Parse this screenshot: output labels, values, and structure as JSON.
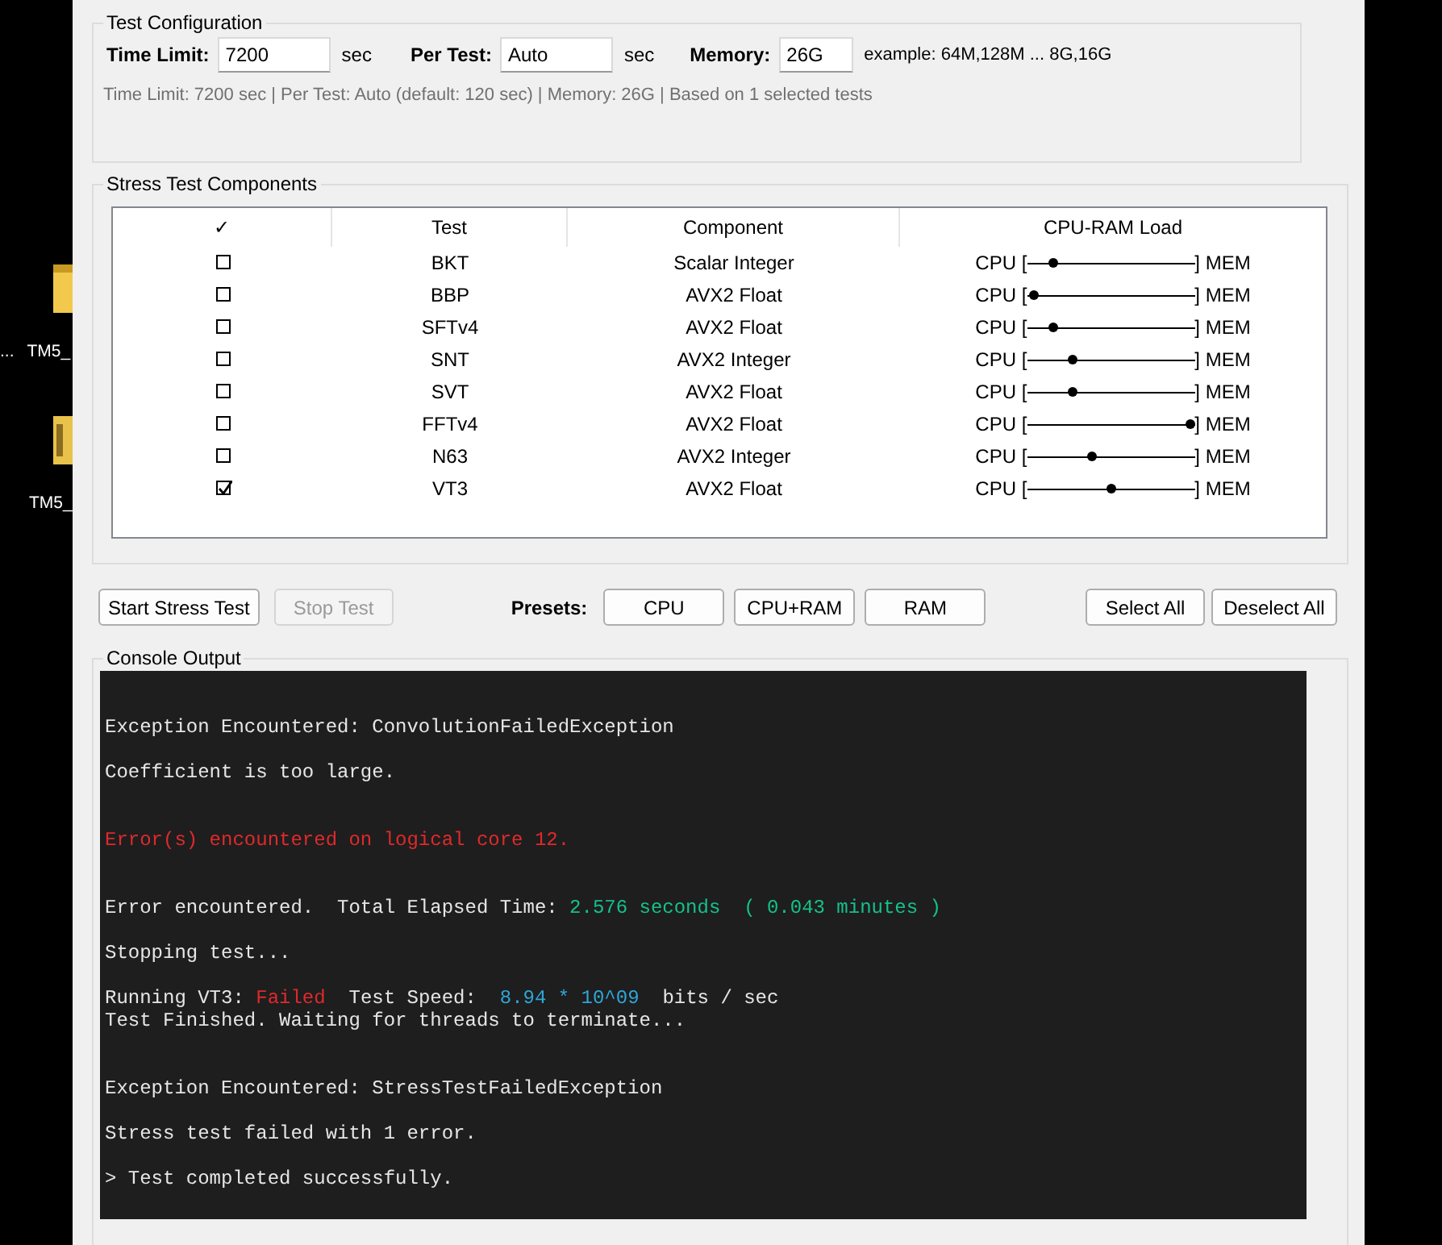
{
  "desktop": {
    "rows": [
      {
        "labels": [
          "...",
          "TM5_"
        ],
        "kind": "file"
      },
      {
        "labels": [
          "TM5_"
        ],
        "kind": "archive"
      }
    ]
  },
  "test_configuration": {
    "title": "Test Configuration",
    "fields": [
      {
        "label": "Time Limit:",
        "value": "7200",
        "unit": "sec"
      },
      {
        "label": "Per Test:",
        "value": "Auto",
        "unit": "sec"
      },
      {
        "label": "Memory:",
        "value": "26G",
        "unit": "example: 64M,128M ... 8G,16G"
      }
    ],
    "summary": "Time Limit: 7200 sec | Per Test: Auto (default: 120 sec) | Memory: 26G | Based on 1 selected tests"
  },
  "components": {
    "title": "Stress Test Components",
    "columns": [
      "✓",
      "Test",
      "Component",
      "CPU-RAM Load"
    ],
    "rows": [
      {
        "checked": false,
        "test": "BKT",
        "component": "Scalar Integer",
        "left": "CPU [",
        "right": "] MEM",
        "level": 0.16
      },
      {
        "checked": false,
        "test": "BBP",
        "component": "AVX2 Float",
        "left": "CPU [",
        "right": "] MEM",
        "level": 0.04
      },
      {
        "checked": false,
        "test": "SFTv4",
        "component": "AVX2 Float",
        "left": "CPU [",
        "right": "] MEM",
        "level": 0.16
      },
      {
        "checked": false,
        "test": "SNT",
        "component": "AVX2 Integer",
        "left": "CPU [",
        "right": "] MEM",
        "level": 0.27
      },
      {
        "checked": false,
        "test": "SVT",
        "component": "AVX2 Float",
        "left": "CPU [",
        "right": "] MEM",
        "level": 0.27
      },
      {
        "checked": false,
        "test": "FFTv4",
        "component": "AVX2 Float",
        "left": "CPU [",
        "right": "] MEM",
        "level": 0.97
      },
      {
        "checked": false,
        "test": "N63",
        "component": "AVX2 Integer",
        "left": "CPU [",
        "right": "] MEM",
        "level": 0.385
      },
      {
        "checked": true,
        "test": "VT3",
        "component": "AVX2 Float",
        "left": "CPU [",
        "right": "] MEM",
        "level": 0.5
      }
    ]
  },
  "controls": {
    "start": {
      "label": "Start Stress Test",
      "disabled": false
    },
    "stop": {
      "label": "Stop Test",
      "disabled": true
    },
    "presets_label": "Presets:",
    "presets": [
      "CPU",
      "CPU+RAM",
      "RAM"
    ],
    "select_all": "Select All",
    "deselect_all": "Deselect All"
  },
  "console": {
    "title": "Console Output",
    "lines": [
      {
        "kind": "blank"
      },
      {
        "kind": "blank"
      },
      {
        "kind": "text",
        "segments": [
          {
            "text": "Exception Encountered: ConvolutionFailedException",
            "color": "#e6e6e6"
          }
        ]
      },
      {
        "kind": "blank"
      },
      {
        "kind": "text",
        "segments": [
          {
            "text": "Coefficient is too large.",
            "color": "#e6e6e6"
          }
        ]
      },
      {
        "kind": "blank"
      },
      {
        "kind": "blank"
      },
      {
        "kind": "text",
        "segments": [
          {
            "text": "Error(s) encountered on logical core 12.",
            "color": "#e0292c"
          }
        ]
      },
      {
        "kind": "blank"
      },
      {
        "kind": "blank"
      },
      {
        "kind": "text",
        "segments": [
          {
            "text": "Error encountered.  Total Elapsed Time: ",
            "color": "#e6e6e6"
          },
          {
            "text": "2.576 seconds  ( 0.043 minutes )",
            "color": "#16c08a"
          }
        ]
      },
      {
        "kind": "blank"
      },
      {
        "kind": "text",
        "segments": [
          {
            "text": "Stopping test...",
            "color": "#e6e6e6"
          }
        ]
      },
      {
        "kind": "blank"
      },
      {
        "kind": "text",
        "segments": [
          {
            "text": "Running VT3: ",
            "color": "#e6e6e6"
          },
          {
            "text": "Failed",
            "color": "#e0292c"
          },
          {
            "text": "  Test Speed:  ",
            "color": "#e6e6e6"
          },
          {
            "text": "8.94 * 10^09",
            "color": "#2ea6d8"
          },
          {
            "text": "  bits / sec",
            "color": "#e6e6e6"
          }
        ]
      },
      {
        "kind": "text",
        "segments": [
          {
            "text": "Test Finished. Waiting for threads to terminate...",
            "color": "#e6e6e6"
          }
        ]
      },
      {
        "kind": "blank"
      },
      {
        "kind": "blank"
      },
      {
        "kind": "text",
        "segments": [
          {
            "text": "Exception Encountered: StressTestFailedException",
            "color": "#e6e6e6"
          }
        ]
      },
      {
        "kind": "blank"
      },
      {
        "kind": "text",
        "segments": [
          {
            "text": "Stress test failed with 1 error.",
            "color": "#e6e6e6"
          }
        ]
      },
      {
        "kind": "blank"
      },
      {
        "kind": "text",
        "segments": [
          {
            "text": "> Test completed successfully.",
            "color": "#e6e6e6"
          }
        ]
      }
    ]
  }
}
